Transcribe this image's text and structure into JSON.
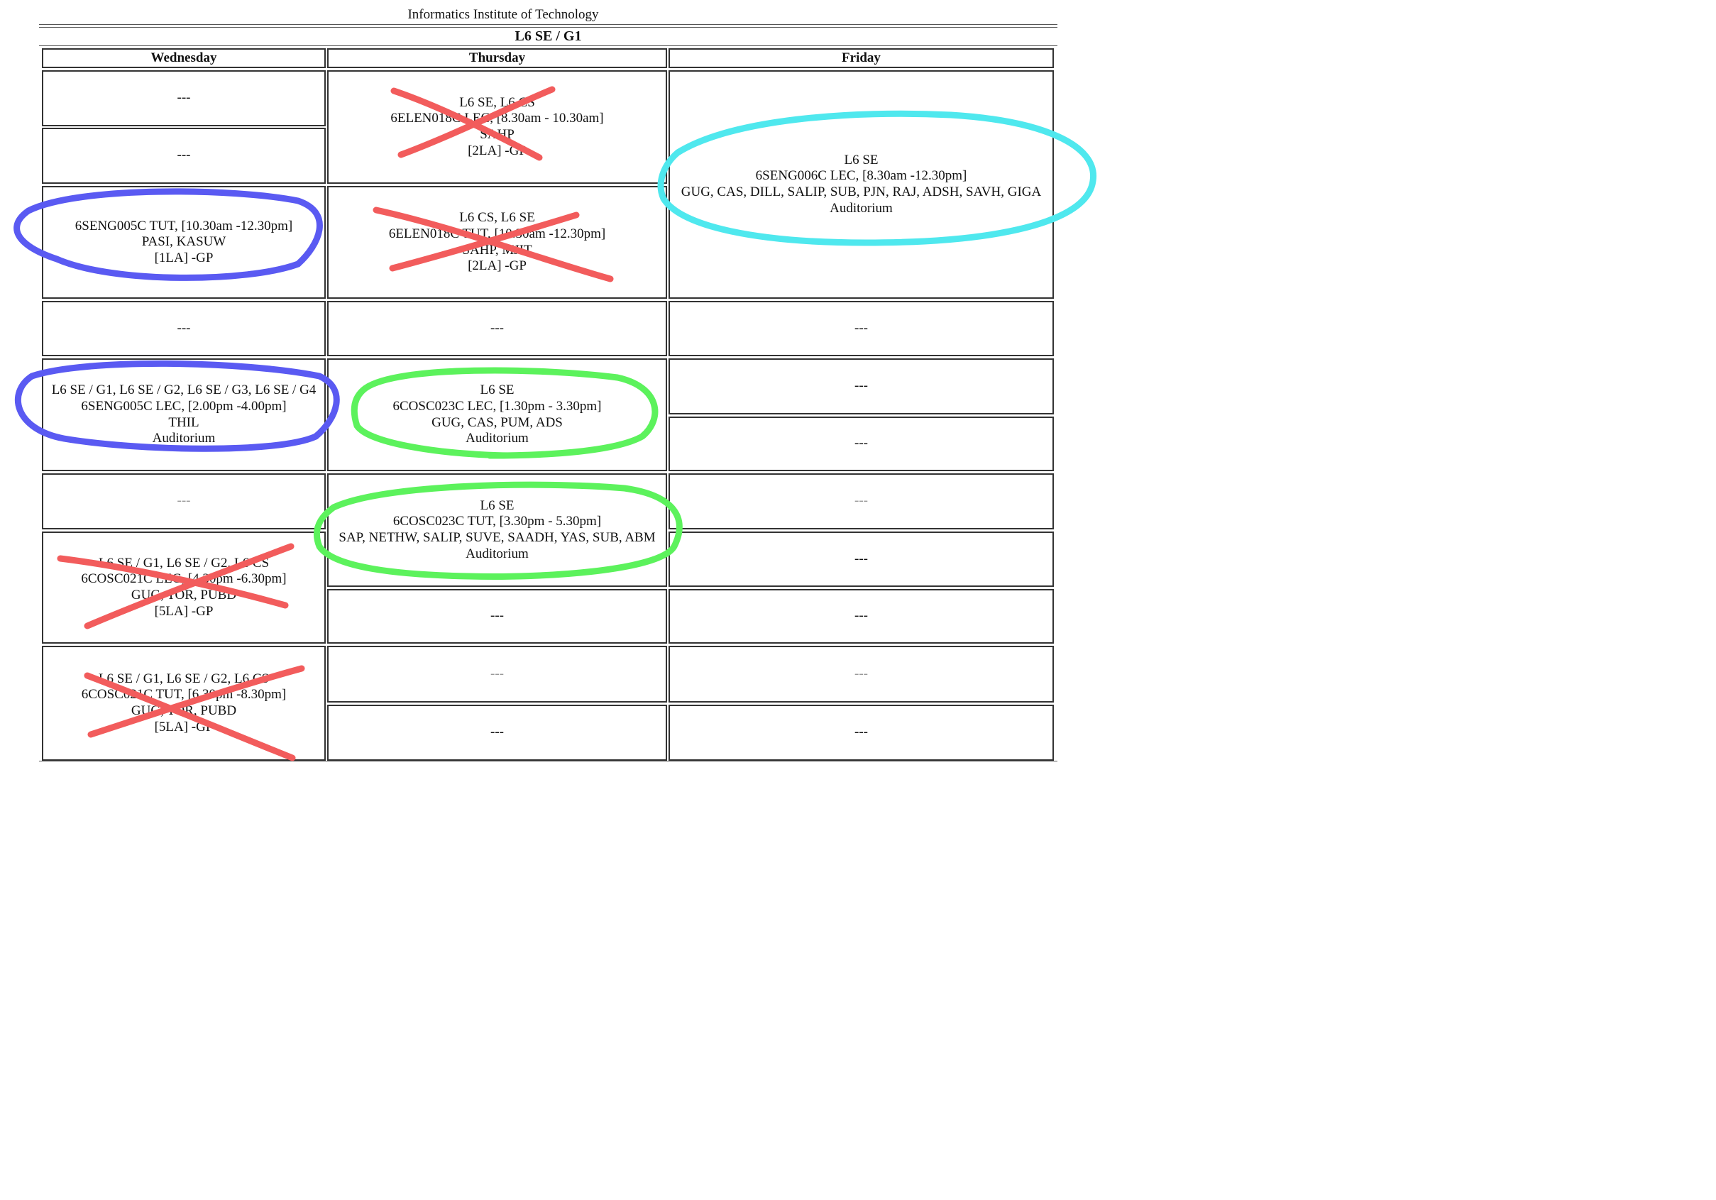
{
  "institute": "Informatics Institute of Technology",
  "group": "L6 SE / G1",
  "days": [
    "Wednesday",
    "Thursday",
    "Friday"
  ],
  "empty": "---",
  "wed": {
    "s1": "---",
    "s2": "---",
    "tut": [
      "6SENG005C TUT, [10.30am -12.30pm]",
      "PASI, KASUW",
      "[1LA] -GP"
    ],
    "s4": "---",
    "lec": [
      "L6 SE / G1, L6 SE / G2, L6 SE / G3, L6 SE / G4",
      "6SENG005C LEC, [2.00pm -4.00pm]",
      "THIL",
      "Auditorium"
    ],
    "s6": "---",
    "cosc_lec": [
      "L6 SE / G1, L6 SE / G2, L6 CS",
      "6COSC021C LEC, [4.30pm -6.30pm]",
      "GUG, TOR, PUBD",
      "[5LA] -GP"
    ],
    "cosc_tut": [
      "L6 SE / G1, L6 SE / G2, L6 CS",
      "6COSC021C TUT, [6.30pm -8.30pm]",
      "GUG, TOR, PUBD",
      "[5LA] -GP"
    ]
  },
  "thu": {
    "elen_lec": [
      "L6 SE, L6 CS",
      "6ELEN018C LEC, [8.30am - 10.30am]",
      "SAHP",
      "[2LA] -GP"
    ],
    "elen_tut": [
      "L6 CS, L6 SE",
      "6ELEN018C TUT, [10.30am -12.30pm]",
      "SAHP, MJIT",
      "[2LA] -GP"
    ],
    "s3": "---",
    "cosc_lec": [
      "L6 SE",
      "6COSC023C LEC, [1.30pm - 3.30pm]",
      "GUG, CAS, PUM, ADS",
      "Auditorium"
    ],
    "cosc_tut": [
      "L6 SE",
      "6COSC023C TUT, [3.30pm - 5.30pm]",
      "SAP, NETHW, SALIP, SUVE, SAADH, YAS, SUB, ABM",
      "Auditorium"
    ],
    "s6": "---",
    "s7": "---",
    "s8": "---"
  },
  "fri": {
    "seng_lec": [
      "L6 SE",
      "6SENG006C LEC, [8.30am -12.30pm]",
      "GUG, CAS, DILL, SALIP, SUB, PJN, RAJ, ADSH, SAVH, GIGA",
      "Auditorium"
    ],
    "s2": "---",
    "s3": "---",
    "s4": "---",
    "s5": "---",
    "s6": "---",
    "s7": "---",
    "s8": "---",
    "s9": "---"
  },
  "colors": {
    "blue": "#5a5af2",
    "cyan": "#4fe8ee",
    "green": "#5cf25c",
    "red": "#f25c5c"
  }
}
